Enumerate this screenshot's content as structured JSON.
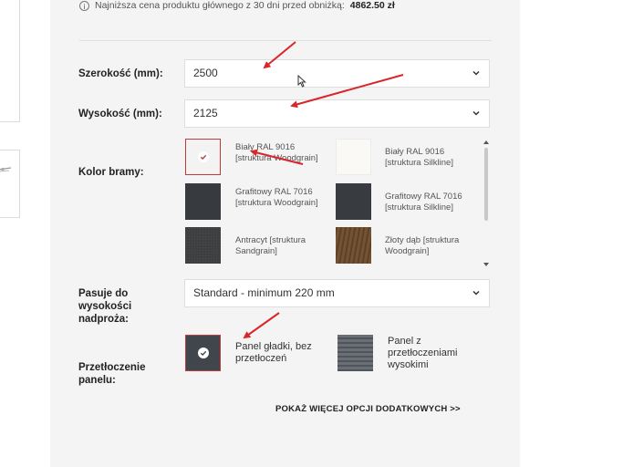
{
  "price_note": {
    "text": "Najniższa cena produktu głównego z 30 dni przed obniżką:",
    "value": "4862.50 zł"
  },
  "width": {
    "label": "Szerokość (mm):",
    "value": "2500"
  },
  "height": {
    "label": "Wysokość (mm):",
    "value": "2125"
  },
  "gate_color": {
    "label": "Kolor bramy:",
    "options": [
      {
        "label": "Biały RAL 9016 [struktura Woodgrain]",
        "color": "#f3f3f3",
        "selected": true
      },
      {
        "label": "Biały RAL 9016 [struktura Silkline]",
        "color": "#faf9f5",
        "selected": false
      },
      {
        "label": "Grafitowy RAL 7016 [struktura Woodgrain]",
        "color": "#373b40",
        "selected": false
      },
      {
        "label": "Grafitowy RAL 7016 [struktura Silkline]",
        "color": "#383c41",
        "selected": false
      },
      {
        "label": "Antracyt [struktura Sandgrain]",
        "color": "#3e3f41",
        "selected": false
      },
      {
        "label": "Złoty dąb [struktura Woodgrain]",
        "color": "#6b4a2a",
        "selected": false
      }
    ]
  },
  "lintel": {
    "label": "Pasuje do wysokości nadproża:",
    "value": "Standard - minimum 220 mm"
  },
  "panel_embossing": {
    "label": "Przetłoczenie panelu:",
    "options": [
      {
        "label": "Panel gładki, bez przetłoczeń",
        "color": "#41464d",
        "selected": true
      },
      {
        "label": "Panel z przetłoczeniami wysokimi",
        "color": "#5c6168",
        "selected": false
      }
    ]
  },
  "more_options_link": "POKAŻ WIĘCEJ OPCJI DODATKOWYCH >>",
  "accent_color": "#c0393b"
}
